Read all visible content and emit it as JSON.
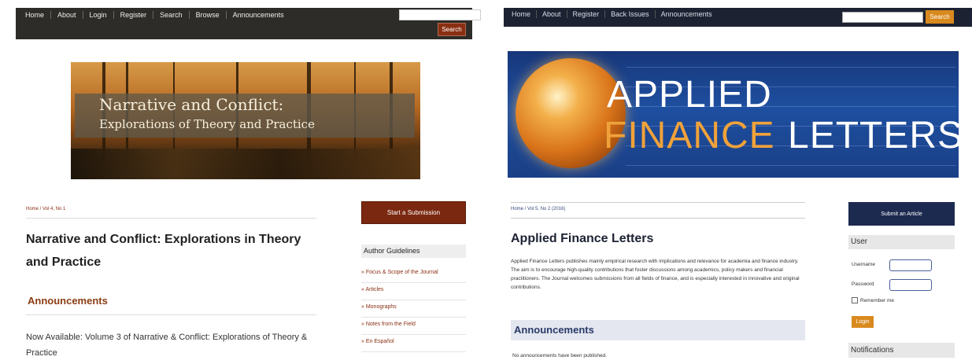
{
  "left": {
    "nav": {
      "links": [
        "Home",
        "About",
        "Login",
        "Register",
        "Search",
        "Browse",
        "Announcements"
      ],
      "search_button": "Search"
    },
    "banner": {
      "title_line1": "Narrative and Conflict:",
      "title_line2": "Explorations of Theory and Practice"
    },
    "breadcrumb": "Home / Vol 4, No 1",
    "page_title": "Narrative and Conflict: Explorations in Theory and Practice",
    "announcements_heading": "Announcements",
    "announcement_text": "Now Available: Volume 3 of Narrative & Conflict: Explorations of Theory & Practice",
    "sidebar": {
      "submit_button": "Start a Submission",
      "guidelines_heading": "Author Guidelines",
      "items": [
        "» Focus & Scope of the Journal",
        "» Articles",
        "» Monographs",
        "» Notes from the Field",
        "» En Español"
      ]
    },
    "colors": {
      "nav_bg": "#2d2c28",
      "accent": "#8a2f12"
    }
  },
  "right": {
    "nav": {
      "links": [
        "Home",
        "About",
        "Register",
        "Back Issues",
        "Announcements"
      ],
      "search_button": "Search"
    },
    "banner": {
      "word_applied": "APPLIED",
      "word_finance": "FINANCE",
      "word_letters": "LETTERS"
    },
    "breadcrumb": "Home / Vol 5, No 2 (2016)",
    "page_title": "Applied Finance Letters",
    "description": "Applied Finance Letters publishes mainly empirical research with implications and relevance for academia and finance industry. The aim is to encourage high-quality contributions that foster discussions among academics, policy makers and financial practitioners. The Journal welcomes submissions from all fields of finance, and is especially interested in innovative and original contributions.",
    "announcements_heading": "Announcements",
    "announcement_text": "No announcements have been published.",
    "sidebar": {
      "submit_button": "Submit an Article",
      "user_heading": "User",
      "username_label": "Username",
      "password_label": "Password",
      "remember_label": "Remember me",
      "login_button": "Login",
      "notifications_heading": "Notifications"
    },
    "colors": {
      "nav_bg": "#1d2233",
      "accent": "#d98a1e"
    }
  }
}
